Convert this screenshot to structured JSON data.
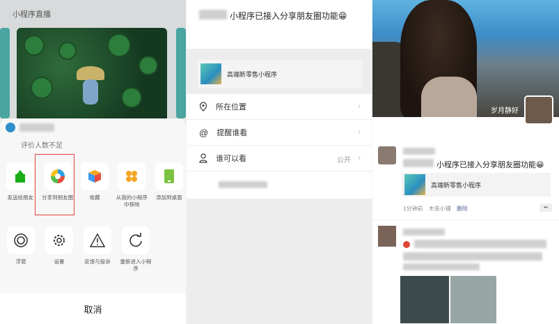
{
  "panel1": {
    "section_title": "小程序直播",
    "rating": "评价人数不足",
    "actions_row1": [
      {
        "label": "发送给朋友",
        "icon": "share-to-friend-icon"
      },
      {
        "label": "分享到朋友圈",
        "icon": "moments-aperture-icon"
      },
      {
        "label": "收藏",
        "icon": "favorite-cube-icon"
      },
      {
        "label": "从我的小程序中移除",
        "icon": "remove-miniprogram-icon"
      },
      {
        "label": "添加到桌面",
        "icon": "add-to-desktop-icon"
      }
    ],
    "actions_row2": [
      {
        "label": "浮窗",
        "icon": "float-window-icon"
      },
      {
        "label": "设置",
        "icon": "settings-gear-icon"
      },
      {
        "label": "反馈与投诉",
        "icon": "feedback-warning-icon"
      },
      {
        "label": "重新进入小程序",
        "icon": "reload-icon"
      }
    ],
    "cancel": "取消"
  },
  "panel2": {
    "header_text": "小程序已接入分享朋友圈功能😁",
    "card_title": "高端新零售小程序",
    "rows": [
      {
        "label": "所在位置",
        "icon": "location-pin-icon",
        "value": ""
      },
      {
        "label": "提醒谁看",
        "icon": "at-sign-icon",
        "value": ""
      },
      {
        "label": "谁可以看",
        "icon": "person-icon",
        "value": "公开"
      }
    ]
  },
  "panel3": {
    "cover_name": "岁月静好",
    "post_text": "小程序已接入分享朋友圈功能😁",
    "card_title": "高端新零售小程序",
    "meta": {
      "time": "1分钟前",
      "source": "木虫小铺",
      "delete": "删除"
    },
    "more": "••"
  }
}
